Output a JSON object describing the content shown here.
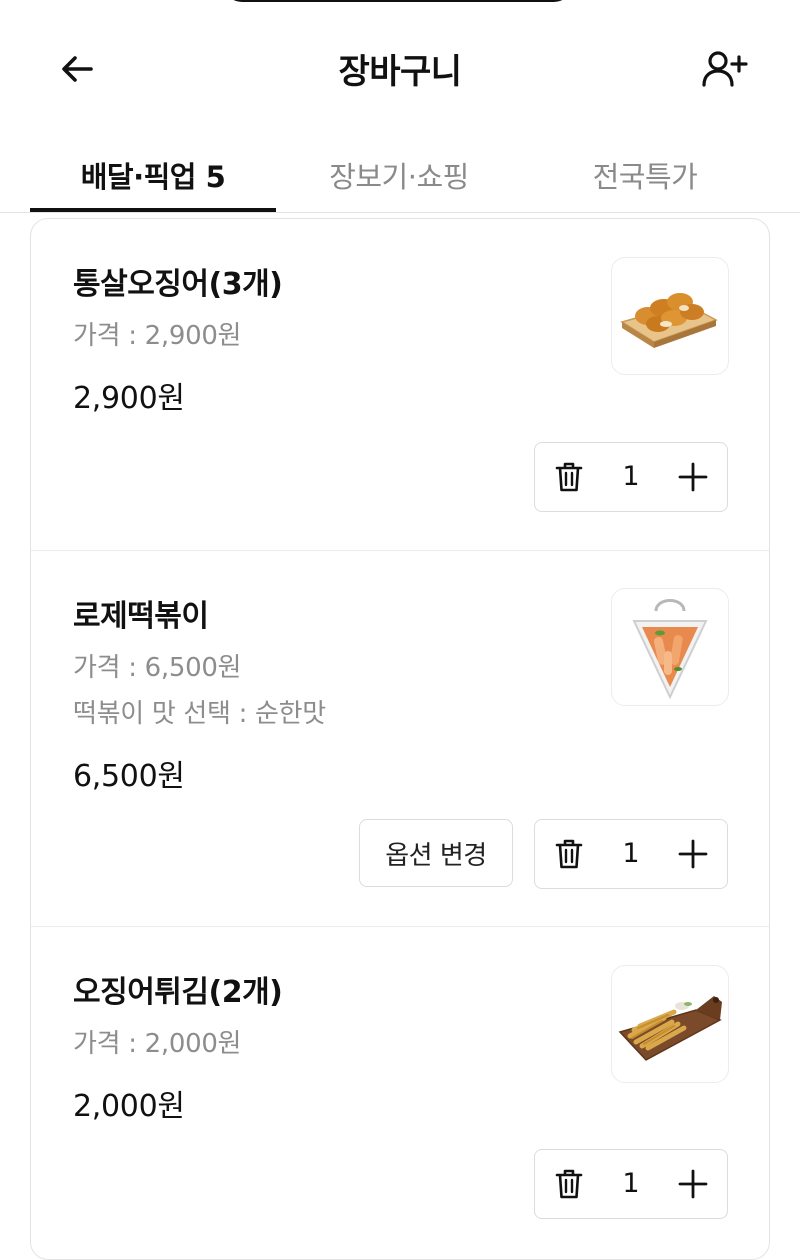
{
  "header": {
    "title": "장바구니",
    "back_icon": "arrow-left-icon",
    "invite_icon": "user-plus-icon"
  },
  "tabs": [
    {
      "label": "배달·픽업 5",
      "active": true
    },
    {
      "label": "장보기·쇼핑",
      "active": false
    },
    {
      "label": "전국특가",
      "active": false
    }
  ],
  "cart": {
    "items": [
      {
        "name": "통살오징어(3개)",
        "price_line": "가격 : 2,900원",
        "total": "2,900원",
        "quantity": "1",
        "thumbnail": "fried-squid-platter"
      },
      {
        "name": "로제떡볶이",
        "price_line": "가격 : 6,500원",
        "option_line": "떡볶이 맛 선택 : 순한맛",
        "total": "6,500원",
        "quantity": "1",
        "option_button": "옵션 변경",
        "thumbnail": "rose-tteokbokki-cup"
      },
      {
        "name": "오징어튀김(2개)",
        "price_line": "가격 : 2,000원",
        "total": "2,000원",
        "quantity": "1",
        "thumbnail": "squid-tempura-board"
      }
    ]
  },
  "colors": {
    "text": "#111111",
    "muted": "#8d8d8d",
    "border": "#dcdcdc"
  }
}
